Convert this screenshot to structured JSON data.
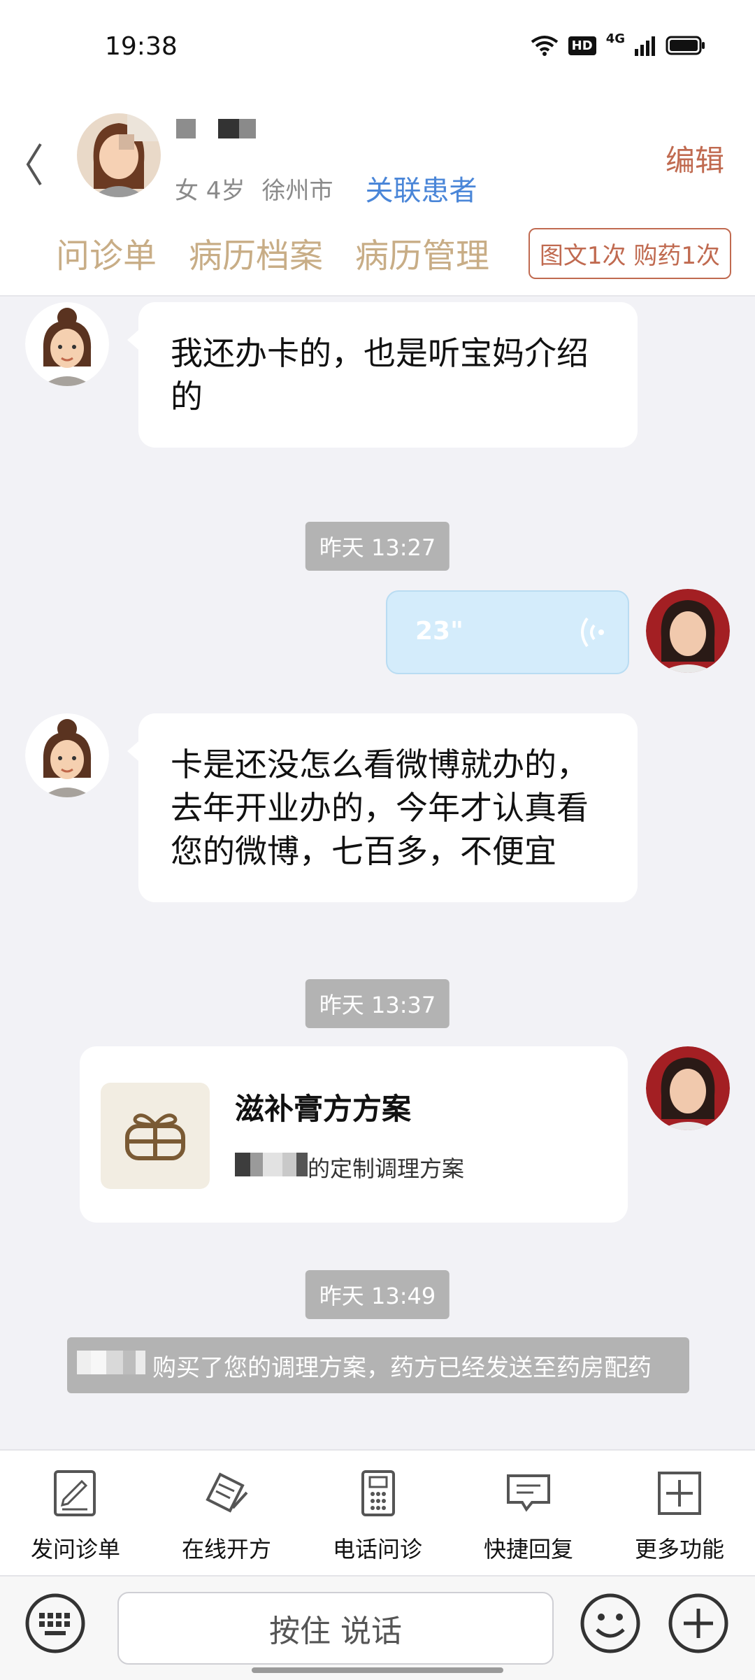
{
  "status_bar": {
    "time": "19:38",
    "hd": "HD",
    "network": "4G"
  },
  "header": {
    "patient_info": {
      "gender_age": "女 4岁",
      "city": "徐州市"
    },
    "link_patient": "关联患者",
    "edit": "编辑",
    "tabs": [
      "问诊单",
      "病历档案",
      "病历管理"
    ],
    "service_stats": "图文1次 购药1次"
  },
  "messages": {
    "m1": "我还办卡的，也是听宝妈介绍的",
    "t1": "昨天 13:27",
    "voice_duration": "23\"",
    "m2": "卡是还没怎么看微博就办的，去年开业办的，今年才认真看您的微博，七百多，不便宜",
    "t2": "昨天 13:37",
    "card_title": "滋补膏方方案",
    "card_sub": "的定制调理方案",
    "t3": "昨天 13:49",
    "system": "购买了您的调理方案，药方已经发送至药房配药"
  },
  "toolbar": [
    {
      "label": "发问诊单",
      "icon": "send-form-icon"
    },
    {
      "label": "在线开方",
      "icon": "prescription-icon"
    },
    {
      "label": "电话问诊",
      "icon": "phone-icon"
    },
    {
      "label": "快捷回复",
      "icon": "quick-reply-icon"
    },
    {
      "label": "更多功能",
      "icon": "more-icon"
    }
  ],
  "input": {
    "hold_to_talk": "按住 说话"
  },
  "colors": {
    "accent_brown": "#c06a50",
    "tab_gold": "#c8ad86",
    "link_blue": "#4a86d8",
    "voice_blue": "#d4ecfb"
  }
}
